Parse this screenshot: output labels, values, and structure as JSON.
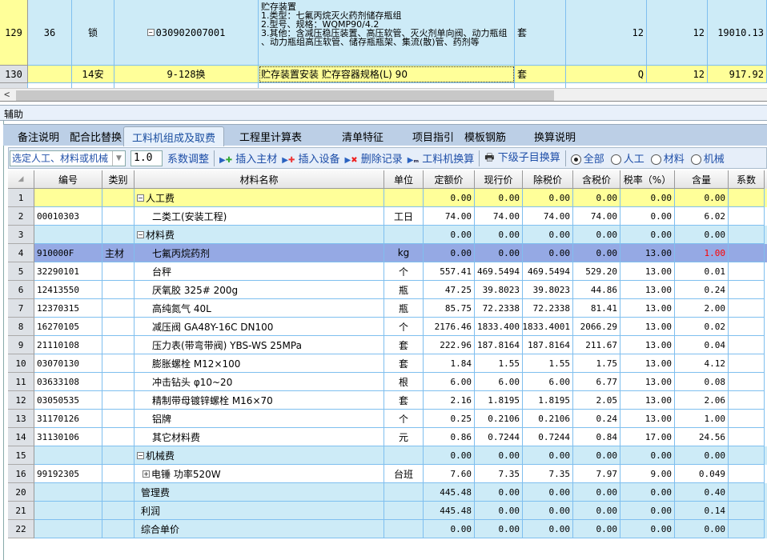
{
  "top_grid": {
    "rows": [
      {
        "no": "129",
        "c1": "36",
        "c2": "锁",
        "code": "030902007001",
        "desc": "贮存装置\n1.类型：七氟丙烷灭火药剂储存瓶组\n2.型号、规格：WQMP90/4.2\n3.其他：含减压稳压装置、高压软管、灭火剂单向阀、动力瓶组 、动力瓶组高压软管、储存瓶瓶架、集流(散)管、药剂等",
        "unit": "套",
        "q1": "12",
        "q2": "12",
        "amount": "19010.13",
        "expand": "minus"
      },
      {
        "no": "130",
        "c1": "",
        "c2": "14安",
        "code": "9-128换",
        "desc": "贮存装置安装 贮存容器规格(L) 90",
        "unit": "套",
        "q1": "Q",
        "q2": "12",
        "amount": "917.92"
      }
    ]
  },
  "aux_title": "辅助",
  "tabs": [
    "备注说明",
    "配合比替换",
    "工料机组成及取费",
    "工程里计算表",
    "清单特征",
    "项目指引",
    "模板钢筋",
    "换算说明"
  ],
  "active_tab": "工料机组成及取费",
  "toolbar": {
    "select_value": "选定人工、材料或机械",
    "coef_value": "1.0",
    "coef_adjust": "系数调整",
    "insert_main": "插入主材",
    "insert_equip": "插入设备",
    "delete_record": "删除记录",
    "glj_convert": "工料机换算",
    "sub_convert": "下级子目换算",
    "filters": [
      "全部",
      "人工",
      "材料",
      "机械"
    ],
    "filter_selected": "全部"
  },
  "columns": [
    "编号",
    "类别",
    "材料名称",
    "单位",
    "定额价",
    "现行价",
    "除税价",
    "含税价",
    "税率（%）",
    "含量",
    "系数"
  ],
  "colors": {
    "group_yellow": "#ffff99",
    "group_blue": "#cdebf7",
    "selected": "#95a9e4",
    "highlight_red": "#ff0000"
  },
  "rows": [
    {
      "no": "1",
      "code": "",
      "type": "",
      "name": "人工费",
      "unit": "",
      "vals": [
        "0.00",
        "0.00",
        "0.00",
        "0.00",
        "0.00",
        "0.00"
      ],
      "style": "yellow",
      "expand": "minus"
    },
    {
      "no": "2",
      "code": "00010303",
      "type": "",
      "name": "二类工(安装工程)",
      "unit": "工日",
      "vals": [
        "74.00",
        "74.00",
        "74.00",
        "74.00",
        "0.00",
        "6.02"
      ],
      "style": "white",
      "indent": true
    },
    {
      "no": "3",
      "code": "",
      "type": "",
      "name": "材料费",
      "unit": "",
      "vals": [
        "0.00",
        "0.00",
        "0.00",
        "0.00",
        "0.00",
        "0.00"
      ],
      "style": "blue",
      "expand": "minus"
    },
    {
      "no": "4",
      "code": "910000F",
      "type": "主材",
      "name": "七氟丙烷药剂",
      "unit": "kg",
      "vals": [
        "0.00",
        "0.00",
        "0.00",
        "0.00",
        "13.00",
        "1.00"
      ],
      "style": "selected",
      "indent": true,
      "red_qty": true
    },
    {
      "no": "5",
      "code": "32290101",
      "type": "",
      "name": "台秤",
      "unit": "个",
      "vals": [
        "557.41",
        "469.5494",
        "469.5494",
        "529.20",
        "13.00",
        "0.01"
      ],
      "style": "white",
      "indent": true
    },
    {
      "no": "6",
      "code": "12413550",
      "type": "",
      "name": "厌氧胶 325# 200g",
      "unit": "瓶",
      "vals": [
        "47.25",
        "39.8023",
        "39.8023",
        "44.86",
        "13.00",
        "0.24"
      ],
      "style": "white",
      "indent": true
    },
    {
      "no": "7",
      "code": "12370315",
      "type": "",
      "name": "高纯氮气 40L",
      "unit": "瓶",
      "vals": [
        "85.75",
        "72.2338",
        "72.2338",
        "81.41",
        "13.00",
        "2.00"
      ],
      "style": "white",
      "indent": true
    },
    {
      "no": "8",
      "code": "16270105",
      "type": "",
      "name": "减压阀 GA48Y-16C DN100",
      "unit": "个",
      "vals": [
        "2176.46",
        "1833.400",
        "1833.4001",
        "2066.29",
        "13.00",
        "0.02"
      ],
      "style": "white",
      "indent": true
    },
    {
      "no": "9",
      "code": "21110108",
      "type": "",
      "name": "压力表(带弯带阀) YBS-WS 25MPa",
      "unit": "套",
      "vals": [
        "222.96",
        "187.8164",
        "187.8164",
        "211.67",
        "13.00",
        "0.04"
      ],
      "style": "white",
      "indent": true
    },
    {
      "no": "10",
      "code": "03070130",
      "type": "",
      "name": "膨胀螺栓 M12×100",
      "unit": "套",
      "vals": [
        "1.84",
        "1.55",
        "1.55",
        "1.75",
        "13.00",
        "4.12"
      ],
      "style": "white",
      "indent": true
    },
    {
      "no": "11",
      "code": "03633108",
      "type": "",
      "name": "冲击钻头 φ10~20",
      "unit": "根",
      "vals": [
        "6.00",
        "6.00",
        "6.00",
        "6.77",
        "13.00",
        "0.08"
      ],
      "style": "white",
      "indent": true
    },
    {
      "no": "12",
      "code": "03050535",
      "type": "",
      "name": "精制带母镀锌螺栓 M16×70",
      "unit": "套",
      "vals": [
        "2.16",
        "1.8195",
        "1.8195",
        "2.05",
        "13.00",
        "2.06"
      ],
      "style": "white",
      "indent": true
    },
    {
      "no": "13",
      "code": "31170126",
      "type": "",
      "name": "铝牌",
      "unit": "个",
      "vals": [
        "0.25",
        "0.2106",
        "0.2106",
        "0.24",
        "13.00",
        "1.00"
      ],
      "style": "white",
      "indent": true
    },
    {
      "no": "14",
      "code": "31130106",
      "type": "",
      "name": "其它材料费",
      "unit": "元",
      "vals": [
        "0.86",
        "0.7244",
        "0.7244",
        "0.84",
        "17.00",
        "24.56"
      ],
      "style": "white",
      "indent": true
    },
    {
      "no": "15",
      "code": "",
      "type": "",
      "name": "机械费",
      "unit": "",
      "vals": [
        "0.00",
        "0.00",
        "0.00",
        "0.00",
        "0.00",
        "0.00"
      ],
      "style": "blue",
      "expand": "minus"
    },
    {
      "no": "16",
      "code": "99192305",
      "type": "",
      "name": "电锤 功率520W",
      "unit": "台班",
      "vals": [
        "7.60",
        "7.35",
        "7.35",
        "7.97",
        "9.00",
        "0.049"
      ],
      "style": "white",
      "expand": "plus",
      "sub": true
    },
    {
      "no": "20",
      "code": "",
      "type": "",
      "name": "管理费",
      "unit": "",
      "vals": [
        "445.48",
        "0.00",
        "0.00",
        "0.00",
        "0.00",
        "0.40"
      ],
      "style": "blue",
      "plain": true
    },
    {
      "no": "21",
      "code": "",
      "type": "",
      "name": "利润",
      "unit": "",
      "vals": [
        "445.48",
        "0.00",
        "0.00",
        "0.00",
        "0.00",
        "0.14"
      ],
      "style": "blue",
      "plain": true
    },
    {
      "no": "22",
      "code": "",
      "type": "",
      "name": "综合单价",
      "unit": "",
      "vals": [
        "0.00",
        "0.00",
        "0.00",
        "0.00",
        "0.00",
        "0.00"
      ],
      "style": "blue",
      "plain": true
    }
  ]
}
